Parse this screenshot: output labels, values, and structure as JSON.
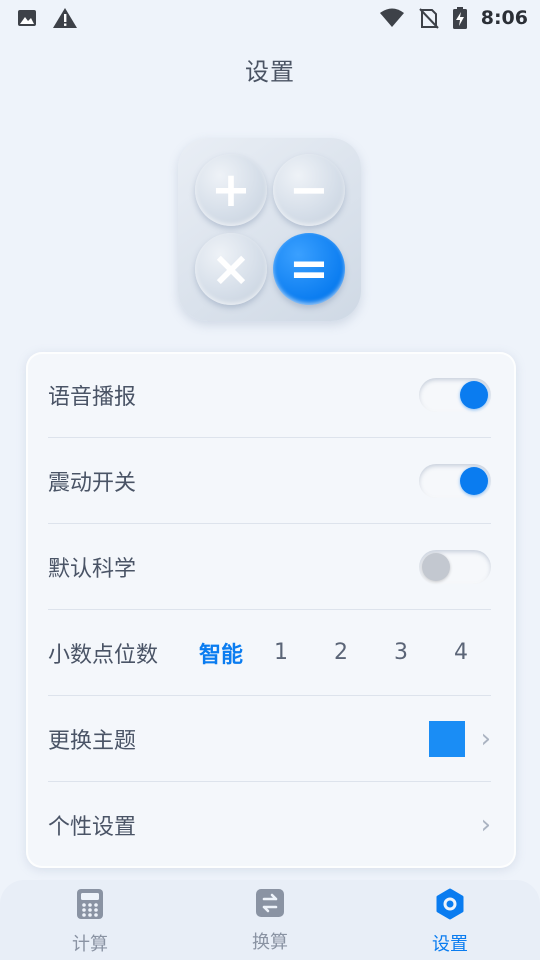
{
  "status_bar": {
    "time": "8:06",
    "left_icons": [
      "image-icon",
      "warning-icon"
    ],
    "right_icons": [
      "wifi-icon",
      "no-sim-icon",
      "battery-charging-icon"
    ]
  },
  "page": {
    "title": "设置"
  },
  "logo": {
    "buttons": [
      "+",
      "−",
      "×",
      "="
    ]
  },
  "settings": {
    "voice_label": "语音播报",
    "voice_on": true,
    "vibration_label": "震动开关",
    "vibration_on": true,
    "scientific_label": "默认科学",
    "scientific_on": false,
    "decimal_label": "小数点位数",
    "decimal_options": [
      "智能",
      "1",
      "2",
      "3",
      "4"
    ],
    "decimal_selected": "智能",
    "theme_label": "更换主题",
    "theme_color": "#1a8df5",
    "personal_label": "个性设置"
  },
  "nav": [
    {
      "label": "计算",
      "icon": "calculator-icon",
      "active": false
    },
    {
      "label": "换算",
      "icon": "exchange-icon",
      "active": false
    },
    {
      "label": "设置",
      "icon": "gear-icon",
      "active": true
    }
  ],
  "colors": {
    "accent": "#0a7cf0",
    "background": "#eef3fa"
  }
}
